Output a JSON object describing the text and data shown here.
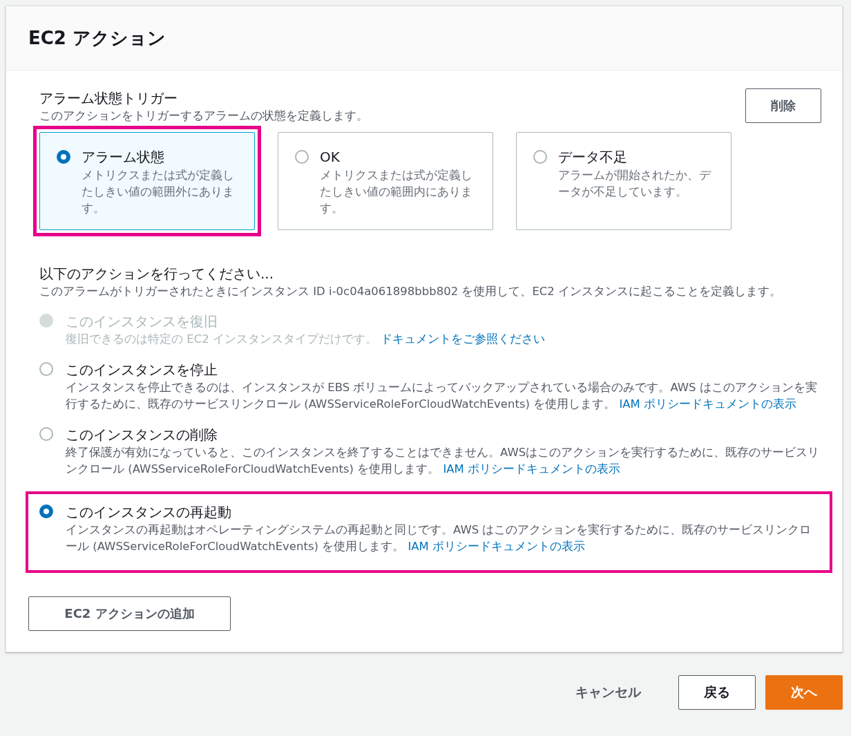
{
  "panel": {
    "title": "EC2 アクション"
  },
  "trigger": {
    "heading": "アラーム状態トリガー",
    "description": "このアクションをトリガーするアラームの状態を定義します。",
    "delete_button": "削除",
    "states": [
      {
        "title": "アラーム状態",
        "description": "メトリクスまたは式が定義したしきい値の範囲外にあります。",
        "selected": true,
        "highlighted": true
      },
      {
        "title": "OK",
        "description": "メトリクスまたは式が定義したしきい値の範囲内にあります。",
        "selected": false,
        "highlighted": false
      },
      {
        "title": "データ不足",
        "description": "アラームが開始されたか、データが不足しています。",
        "selected": false,
        "highlighted": false
      }
    ]
  },
  "actions": {
    "heading": "以下のアクションを行ってください...",
    "description": "このアラームがトリガーされたときにインスタンス ID i-0c04a061898bbb802 を使用して、EC2 インスタンスに起こることを定義します。",
    "options": [
      {
        "title": "このインスタンスを復旧",
        "description": "復旧できるのは特定の EC2 インスタンスタイプだけです。",
        "link": "ドキュメントをご参照ください",
        "selected": false,
        "disabled": true,
        "highlighted": false
      },
      {
        "title": "このインスタンスを停止",
        "description": "インスタンスを停止できるのは、インスタンスが EBS ボリュームによってバックアップされている場合のみです。AWS はこのアクションを実行するために、既存のサービスリンクロール (AWSServiceRoleForCloudWatchEvents) を使用します。",
        "link": "IAM ポリシードキュメントの表示",
        "selected": false,
        "disabled": false,
        "highlighted": false
      },
      {
        "title": "このインスタンスの削除",
        "description": "終了保護が有効になっていると、このインスタンスを終了することはできません。AWSはこのアクションを実行するために、既存のサービスリンクロール (AWSServiceRoleForCloudWatchEvents) を使用します。",
        "link": "IAM ポリシードキュメントの表示",
        "selected": false,
        "disabled": false,
        "highlighted": false
      },
      {
        "title": "このインスタンスの再起動",
        "description": "インスタンスの再起動はオペレーティングシステムの再起動と同じです。AWS はこのアクションを実行するために、既存のサービスリンクロール (AWSServiceRoleForCloudWatchEvents) を使用します。",
        "link": "IAM ポリシードキュメントの表示",
        "selected": true,
        "disabled": false,
        "highlighted": true
      }
    ],
    "add_button": "EC2 アクションの追加"
  },
  "footer": {
    "cancel": "キャンセル",
    "back": "戻る",
    "next": "次へ"
  }
}
